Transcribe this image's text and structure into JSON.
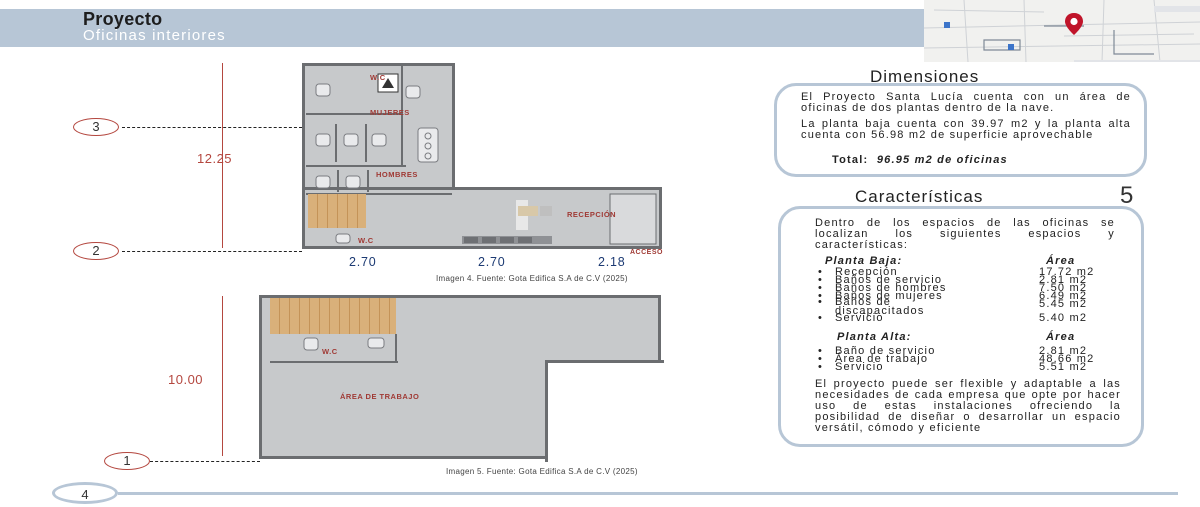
{
  "header": {
    "title": "Proyecto",
    "subtitle": "Oficinas interiores"
  },
  "plans": {
    "axis_labels": [
      "3",
      "2",
      "1"
    ],
    "dimensions_vertical": [
      "12.25",
      "10.00"
    ],
    "dimensions_horizontal": [
      "2.70",
      "2.70",
      "2.18"
    ],
    "upper_rooms": [
      "MUJERES",
      "HOMBRES",
      "W.C",
      "W.C",
      "RECEPCIÓN",
      "ACCESO"
    ],
    "lower_rooms": [
      "W.C",
      "ÁREA DE TRABAJO"
    ],
    "caption_1": "Imagen 4. Fuente: Gota Edifica S.A de C.V (2025)",
    "caption_2": "Imagen 5. Fuente: Gota Edifica S.A de C.V (2025)"
  },
  "dimensiones": {
    "heading": "Dimensiones",
    "p1": "El Proyecto Santa Lucía cuenta con un área de oficinas de dos plantas dentro de la nave.",
    "p2": "La planta baja cuenta con 39.97 m2 y la planta alta cuenta con 56.98 m2 de superficie aprovechable",
    "total_label": "Total:",
    "total_value": "96.95 m2 de oficinas"
  },
  "caracteristicas": {
    "heading": "Características",
    "number": "5",
    "intro": "Dentro de los espacios de las oficinas se localizan los siguientes espacios y características:",
    "planta_baja": {
      "label": "Planta Baja:",
      "area_label": "Área",
      "items": [
        {
          "name": "Recepción",
          "area": "17.72 m2"
        },
        {
          "name": "Baños de servicio",
          "area": "2.81 m2"
        },
        {
          "name": "Baños de hombres",
          "area": "7.50 m2"
        },
        {
          "name": "Baños de mujeres",
          "area": "6.49 m2"
        },
        {
          "name": "Baños de discapacitados",
          "area": "5.45 m2"
        },
        {
          "name": "Servicio",
          "area": "5.40 m2"
        }
      ]
    },
    "planta_alta": {
      "label": "Planta Alta:",
      "area_label": "Área",
      "items": [
        {
          "name": "Baño de servicio",
          "area": "2.81 m2"
        },
        {
          "name": "Área de trabajo",
          "area": "48.66 m2"
        },
        {
          "name": "Servicio",
          "area": "5.51 m2"
        }
      ]
    },
    "closing": "El proyecto puede ser flexible y adaptable a las necesidades de cada empresa que opte por hacer uso de estas instalaciones ofreciendo la posibilidad de diseñar o desarrollar un espacio versátil, cómodo y eficiente"
  },
  "footer": {
    "page_number": "4"
  },
  "colors": {
    "accent_band": "#b7c6d6",
    "dimension_red": "#b4473f",
    "dimension_blue": "#1c3a73"
  }
}
